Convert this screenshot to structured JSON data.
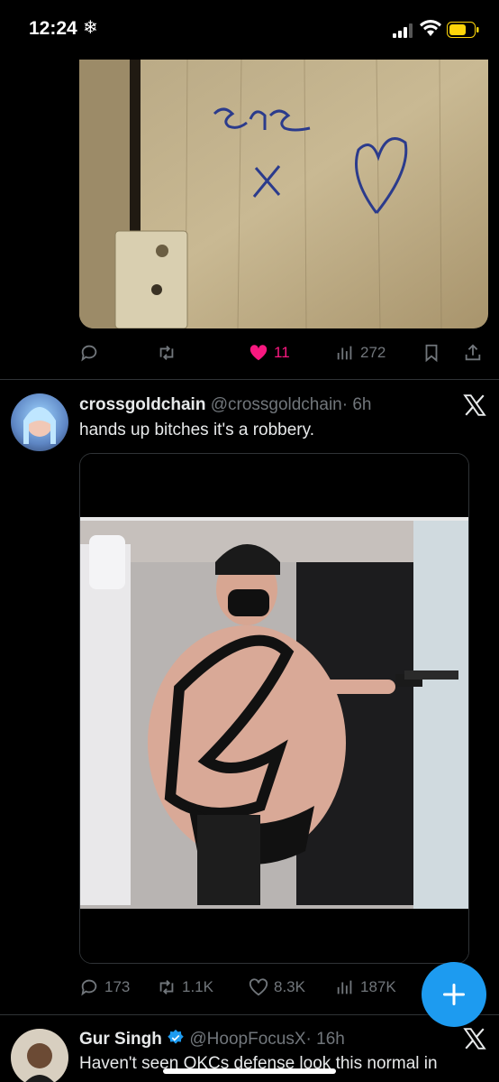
{
  "status_bar": {
    "time": "12:24",
    "focus_glyph": "❄"
  },
  "tweet1": {
    "stats": {
      "likes": "11",
      "views": "272"
    }
  },
  "tweet2": {
    "display_name": "crossgoldchain",
    "handle": "@crossgoldchain",
    "time": "· 6h",
    "text": "hands up bitches it's a robbery.",
    "stats": {
      "replies": "173",
      "retweets": "1.1K",
      "likes": "8.3K",
      "views": "187K"
    }
  },
  "tweet3": {
    "display_name": "Gur Singh",
    "handle": "@HoopFocusX",
    "time": "· 16h",
    "text": "Haven't seen OKCs defense look this normal in"
  },
  "colors": {
    "accent": "#1d9bf0",
    "like": "#f91880",
    "muted": "#71767b",
    "background": "#000000"
  },
  "icons": [
    "reply-icon",
    "retweet-icon",
    "like-icon",
    "views-icon",
    "bookmark-icon",
    "share-icon",
    "x-logo-icon",
    "compose-icon",
    "verified-icon"
  ]
}
